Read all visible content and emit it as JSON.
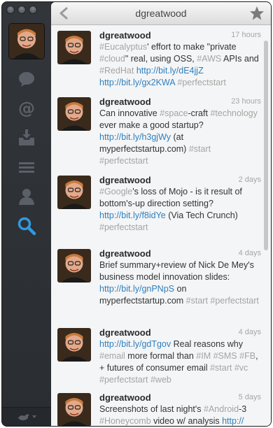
{
  "window": {
    "title": "dgreatwood"
  },
  "sidebar": {
    "items": [
      {
        "name": "timeline-bubble-icon",
        "active": false
      },
      {
        "name": "mentions-at-icon",
        "active": false
      },
      {
        "name": "inbox-tray-icon",
        "active": false
      },
      {
        "name": "lists-icon",
        "active": false
      },
      {
        "name": "profile-person-icon",
        "active": false
      },
      {
        "name": "search-icon",
        "active": true
      }
    ],
    "accent": "#2e9be0"
  },
  "tweets": [
    {
      "user": "dgreatwood",
      "time": "17 hours",
      "parts": [
        {
          "t": "#Eucalyptus",
          "c": "tag"
        },
        {
          "t": "' effort to make \"private ",
          "c": "txt"
        },
        {
          "t": "#cloud",
          "c": "tag"
        },
        {
          "t": "\" real, using OSS, ",
          "c": "txt"
        },
        {
          "t": "#AWS",
          "c": "tag"
        },
        {
          "t": " APIs and ",
          "c": "txt"
        },
        {
          "t": "#RedHat",
          "c": "tag"
        },
        {
          "t": " ",
          "c": "txt"
        },
        {
          "t": "http://bit.ly/dE4jjZ",
          "c": "lnk"
        },
        {
          "t": " ",
          "c": "txt"
        },
        {
          "t": "http://bit.ly/gx2KWA",
          "c": "lnk"
        },
        {
          "t": " ",
          "c": "txt"
        },
        {
          "t": "#perfectstart",
          "c": "tag"
        }
      ]
    },
    {
      "user": "dgreatwood",
      "time": "23 hours",
      "parts": [
        {
          "t": "Can innovative ",
          "c": "txt"
        },
        {
          "t": "#space",
          "c": "tag"
        },
        {
          "t": "-craft ",
          "c": "txt"
        },
        {
          "t": "#technology",
          "c": "tag"
        },
        {
          "t": " ever make a good startup? ",
          "c": "txt"
        },
        {
          "t": "http://bit.ly/h3gjWy",
          "c": "lnk"
        },
        {
          "t": " (at myperfectstartup.com) ",
          "c": "txt"
        },
        {
          "t": "#start",
          "c": "tag"
        },
        {
          "t": " ",
          "c": "txt"
        },
        {
          "t": "#perfectstart",
          "c": "tag"
        }
      ]
    },
    {
      "user": "dgreatwood",
      "time": "2 days",
      "parts": [
        {
          "t": "#Google",
          "c": "tag"
        },
        {
          "t": "'s loss of Mojo - is it result of bottom's-up direction setting? ",
          "c": "txt"
        },
        {
          "t": "http://bit.ly/f8idYe",
          "c": "lnk"
        },
        {
          "t": " (Via Tech Crunch) ",
          "c": "txt"
        },
        {
          "t": "#perfectstart",
          "c": "tag"
        }
      ]
    },
    {
      "user": "dgreatwood",
      "time": "4 days",
      "parts": [
        {
          "t": "Brief summary+review of Nick De Mey's business model innovation slides: ",
          "c": "txt"
        },
        {
          "t": "http://bit.ly/gnPNpS",
          "c": "lnk"
        },
        {
          "t": " on myperfectstartup.com ",
          "c": "txt"
        },
        {
          "t": "#start",
          "c": "tag"
        },
        {
          "t": " ",
          "c": "txt"
        },
        {
          "t": "#perfectstart",
          "c": "tag"
        }
      ]
    },
    {
      "user": "dgreatwood",
      "time": "4 days",
      "parts": [
        {
          "t": "http://bit.ly/gdTgov",
          "c": "lnk"
        },
        {
          "t": " Real reasons why ",
          "c": "txt"
        },
        {
          "t": "#email",
          "c": "tag"
        },
        {
          "t": " more formal than ",
          "c": "txt"
        },
        {
          "t": "#IM",
          "c": "tag"
        },
        {
          "t": " ",
          "c": "txt"
        },
        {
          "t": "#SMS",
          "c": "tag"
        },
        {
          "t": " ",
          "c": "txt"
        },
        {
          "t": "#FB",
          "c": "tag"
        },
        {
          "t": ", + futures of consumer email ",
          "c": "txt"
        },
        {
          "t": "#start",
          "c": "tag"
        },
        {
          "t": " ",
          "c": "txt"
        },
        {
          "t": "#vc",
          "c": "tag"
        },
        {
          "t": " ",
          "c": "txt"
        },
        {
          "t": "#perfectstart",
          "c": "tag"
        },
        {
          "t": " ",
          "c": "txt"
        },
        {
          "t": "#web",
          "c": "tag"
        }
      ]
    },
    {
      "user": "dgreatwood",
      "time": "5 days",
      "parts": [
        {
          "t": "Screenshots of last night's ",
          "c": "txt"
        },
        {
          "t": "#Android",
          "c": "tag"
        },
        {
          "t": "-3 ",
          "c": "txt"
        },
        {
          "t": "#Honeycomb",
          "c": "tag"
        },
        {
          "t": " video w/ analysis ",
          "c": "txt"
        },
        {
          "t": "http://",
          "c": "lnk"
        }
      ]
    }
  ]
}
